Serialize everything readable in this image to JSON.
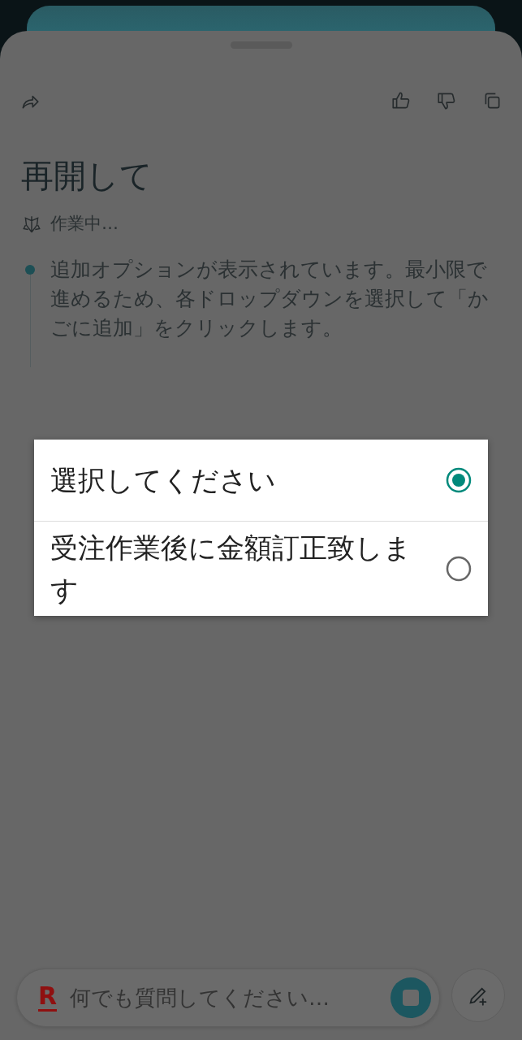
{
  "toolbar": {
    "actions": [
      {
        "kind": "share"
      },
      {
        "kind": "like"
      },
      {
        "kind": "dislike"
      },
      {
        "kind": "copy"
      }
    ]
  },
  "title": "再開して",
  "status": "作業中…",
  "steps": [
    {
      "text": "追加オプションが表示されています。最小限で進めるため、各ドロップダウンを選択して「かごに追加」をクリックします。"
    }
  ],
  "dialog": {
    "options": [
      {
        "label": "選択してください",
        "selected": true
      },
      {
        "label": "受注作業後に金額訂正致します",
        "selected": false
      }
    ]
  },
  "composer": {
    "logo": "R",
    "placeholder": "何でも質問してください…"
  }
}
